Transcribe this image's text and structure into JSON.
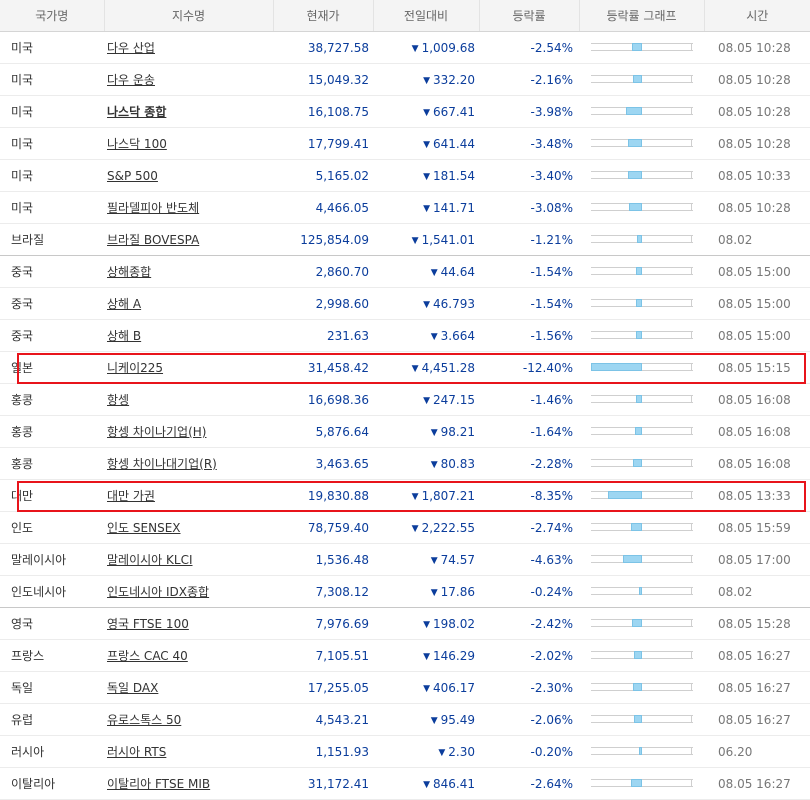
{
  "columns": {
    "country": "국가명",
    "index": "지수명",
    "price": "현재가",
    "change": "전일대비",
    "pct": "등락률",
    "graph": "등락률 그래프",
    "time": "시간"
  },
  "down_arrow": "▼",
  "colors": {
    "down": "#0b3d9c",
    "bar": "#9dd6f2",
    "highlight": "#e8141b"
  },
  "rows": [
    {
      "country": "미국",
      "index": "다우 산업",
      "price": "38,727.58",
      "change": "1,009.68",
      "pct": "-2.54%",
      "time": "08.05 10:28",
      "bar_value": -2.54
    },
    {
      "country": "미국",
      "index": "다우 운송",
      "price": "15,049.32",
      "change": "332.20",
      "pct": "-2.16%",
      "time": "08.05 10:28",
      "bar_value": -2.16
    },
    {
      "country": "미국",
      "index": "나스닥 종합",
      "price": "16,108.75",
      "change": "667.41",
      "pct": "-3.98%",
      "time": "08.05 10:28",
      "bar_value": -3.98,
      "bold": true
    },
    {
      "country": "미국",
      "index": "나스닥 100",
      "price": "17,799.41",
      "change": "641.44",
      "pct": "-3.48%",
      "time": "08.05 10:28",
      "bar_value": -3.48
    },
    {
      "country": "미국",
      "index": "S&P 500",
      "price": "5,165.02",
      "change": "181.54",
      "pct": "-3.40%",
      "time": "08.05 10:33",
      "bar_value": -3.4
    },
    {
      "country": "미국",
      "index": "필라델피아 반도체",
      "price": "4,466.05",
      "change": "141.71",
      "pct": "-3.08%",
      "time": "08.05 10:28",
      "bar_value": -3.08
    },
    {
      "country": "브라질",
      "index": "브라질 BOVESPA",
      "price": "125,854.09",
      "change": "1,541.01",
      "pct": "-1.21%",
      "time": "08.02",
      "bar_value": -1.21,
      "group_end": true
    },
    {
      "country": "중국",
      "index": "상해종합",
      "price": "2,860.70",
      "change": "44.64",
      "pct": "-1.54%",
      "time": "08.05 15:00",
      "bar_value": -1.54
    },
    {
      "country": "중국",
      "index": "상해 A",
      "price": "2,998.60",
      "change": "46.793",
      "pct": "-1.54%",
      "time": "08.05 15:00",
      "bar_value": -1.54
    },
    {
      "country": "중국",
      "index": "상해 B",
      "price": "231.63",
      "change": "3.664",
      "pct": "-1.56%",
      "time": "08.05 15:00",
      "bar_value": -1.56
    },
    {
      "country": "일본",
      "index": "니케이225",
      "price": "31,458.42",
      "change": "4,451.28",
      "pct": "-12.40%",
      "time": "08.05 15:15",
      "bar_value": -12.4
    },
    {
      "country": "홍콩",
      "index": "항셍",
      "price": "16,698.36",
      "change": "247.15",
      "pct": "-1.46%",
      "time": "08.05 16:08",
      "bar_value": -1.46
    },
    {
      "country": "홍콩",
      "index": "항셍 차이나기업(H)",
      "price": "5,876.64",
      "change": "98.21",
      "pct": "-1.64%",
      "time": "08.05 16:08",
      "bar_value": -1.64
    },
    {
      "country": "홍콩",
      "index": "항셍 차이나대기업(R)",
      "price": "3,463.65",
      "change": "80.83",
      "pct": "-2.28%",
      "time": "08.05 16:08",
      "bar_value": -2.28
    },
    {
      "country": "대만",
      "index": "대만 가권",
      "price": "19,830.88",
      "change": "1,807.21",
      "pct": "-8.35%",
      "time": "08.05 13:33",
      "bar_value": -8.35
    },
    {
      "country": "인도",
      "index": "인도 SENSEX",
      "price": "78,759.40",
      "change": "2,222.55",
      "pct": "-2.74%",
      "time": "08.05 15:59",
      "bar_value": -2.74
    },
    {
      "country": "말레이시아",
      "index": "말레이시아 KLCI",
      "price": "1,536.48",
      "change": "74.57",
      "pct": "-4.63%",
      "time": "08.05 17:00",
      "bar_value": -4.63
    },
    {
      "country": "인도네시아",
      "index": "인도네시아 IDX종합",
      "price": "7,308.12",
      "change": "17.86",
      "pct": "-0.24%",
      "time": "08.02",
      "bar_value": -0.24,
      "group_end": true
    },
    {
      "country": "영국",
      "index": "영국 FTSE 100",
      "price": "7,976.69",
      "change": "198.02",
      "pct": "-2.42%",
      "time": "08.05 15:28",
      "bar_value": -2.42
    },
    {
      "country": "프랑스",
      "index": "프랑스 CAC 40",
      "price": "7,105.51",
      "change": "146.29",
      "pct": "-2.02%",
      "time": "08.05 16:27",
      "bar_value": -2.02
    },
    {
      "country": "독일",
      "index": "독일 DAX",
      "price": "17,255.05",
      "change": "406.17",
      "pct": "-2.30%",
      "time": "08.05 16:27",
      "bar_value": -2.3
    },
    {
      "country": "유럽",
      "index": "유로스톡스 50",
      "price": "4,543.21",
      "change": "95.49",
      "pct": "-2.06%",
      "time": "08.05 16:27",
      "bar_value": -2.06
    },
    {
      "country": "러시아",
      "index": "러시아 RTS",
      "price": "1,151.93",
      "change": "2.30",
      "pct": "-0.20%",
      "time": "06.20",
      "bar_value": -0.2
    },
    {
      "country": "이탈리아",
      "index": "이탈리아 FTSE MIB",
      "price": "31,172.41",
      "change": "846.41",
      "pct": "-2.64%",
      "time": "08.05 16:27",
      "bar_value": -2.64
    }
  ],
  "highlighted_rows": [
    10,
    14
  ]
}
